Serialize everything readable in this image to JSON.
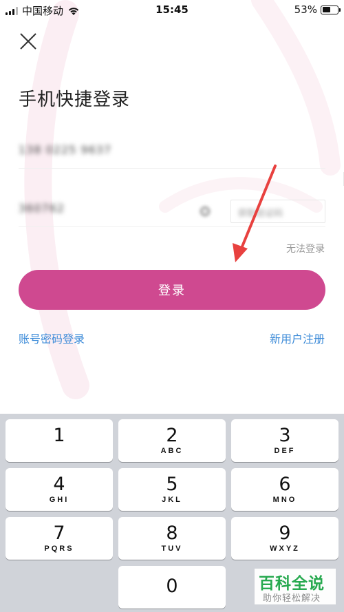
{
  "status_bar": {
    "carrier": "中国移动",
    "time": "15:45",
    "battery_percent": "53%",
    "battery_level": 0.53
  },
  "header": {
    "close_icon": "close-icon",
    "title": "手机快捷登录"
  },
  "form": {
    "phone_value": "138 0225 9637",
    "code_value": "360762",
    "code_button_label": "获取验证码"
  },
  "links": {
    "cant_login": "无法登录",
    "password_login": "账号密码登录",
    "register": "新用户注册"
  },
  "login_button": {
    "label": "登录"
  },
  "keypad": {
    "keys": [
      {
        "num": "1",
        "letters": ""
      },
      {
        "num": "2",
        "letters": "ABC"
      },
      {
        "num": "3",
        "letters": "DEF"
      },
      {
        "num": "4",
        "letters": "GHI"
      },
      {
        "num": "5",
        "letters": "JKL"
      },
      {
        "num": "6",
        "letters": "MNO"
      },
      {
        "num": "7",
        "letters": "PQRS"
      },
      {
        "num": "8",
        "letters": "TUV"
      },
      {
        "num": "9",
        "letters": "WXYZ"
      },
      {
        "num": "0",
        "letters": ""
      }
    ]
  },
  "watermark": {
    "title": "百科全说",
    "subtitle": "助你轻松解决"
  },
  "colors": {
    "accent": "#cf4990",
    "link": "#3d8bd8",
    "keypad_bg": "#d0d3d9",
    "watermark_green": "#21a84a"
  }
}
